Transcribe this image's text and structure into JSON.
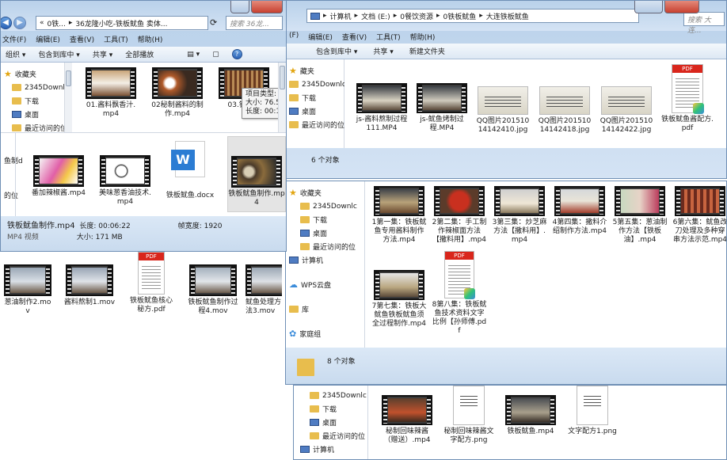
{
  "win_left": {
    "address_parts": [
      "0铁...",
      "36龙隆小吃-铁板鱿鱼 卖体..."
    ],
    "search_placeholder": "搜索 36龙...",
    "menu": [
      "文件(F)",
      "编辑(E)",
      "查看(V)",
      "工具(T)",
      "帮助(H)"
    ],
    "toolbar": [
      "组织",
      "包含到库中",
      "共享",
      "全部播放"
    ],
    "nav": [
      "收藏夹",
      "2345Downlc",
      "下载",
      "桌面",
      "最近访问的位"
    ],
    "files_row1": [
      "01.酱料飘香汁.mp4",
      "02秘制酱料的制作.mp4",
      "03.铁板..."
    ],
    "tooltip": [
      "项目类型: MP4 视频",
      "大小: 76.5 MB",
      "长度: 00:18:36"
    ],
    "nav2": [
      "鱼制d",
      "的位"
    ],
    "files_row2": [
      "番加辣椒酱.mp4",
      "美味葱香油技术.mp4",
      "铁板鱿鱼.docx",
      "铁板鱿鱼制作.mp4"
    ],
    "status": {
      "name": "铁板鱿鱼制作.mp4",
      "length_label": "长度: 00:06:22",
      "frame_label": "帧宽度: 1920",
      "type": "MP4 视频",
      "size_label": "大小: 171 MB"
    }
  },
  "win_right": {
    "address_parts": [
      "计算机",
      "文档 (E:)",
      "0餐饮资源",
      "0铁板鱿鱼",
      "大连铁板鱿鱼"
    ],
    "search_placeholder": "搜索 大连...",
    "menu": [
      "(F)",
      "编辑(E)",
      "查看(V)",
      "工具(T)",
      "帮助(H)"
    ],
    "toolbar": [
      "包含到库中",
      "共享",
      "新建文件夹"
    ],
    "nav": [
      "藏夹",
      "2345Downlc",
      "下载",
      "桌面",
      "最近访问的位"
    ],
    "files": [
      "js-酱料熬制过程111.MP4",
      "js-鱿鱼烤制过程.MP4",
      "QQ图片20151014142410.jpg",
      "QQ图片20151014142418.jpg",
      "QQ图片20151014142422.jpg",
      "铁板鱿鱼酱配方.pdf"
    ],
    "count": "6 个对象"
  },
  "win_mid": {
    "nav": [
      "收藏夹",
      "2345Downlc",
      "下载",
      "桌面",
      "最近访问的位",
      "计算机",
      "WPS云盘",
      "库",
      "家庭组"
    ],
    "files": [
      "1第一集：铁板鱿鱼专用酱料制作方法.mp4",
      "2第二集：手工制作辣椒面方法【撒料用】.mp4",
      "3第三集：炒芝麻方法【撒料用】.mp4",
      "4第四集：撒料介绍制作方法.mp4",
      "5第五集：葱油制作方法【铁板油】.mp4",
      "6第六集：鱿鱼改刀处理及多种穿串方法示范.mp4",
      "7第七集：铁板大鱿鱼铁板鱿鱼须全过程制作.mp4",
      "8第八集：铁板鱿鱼技术资料文字比例【孙师傅.pdf"
    ],
    "count": "8 个对象"
  },
  "win_bg_files": [
    "葱油制作2.mov",
    "酱料熬制1.mov",
    "铁板鱿鱼核心秘方.pdf",
    "铁板鱿鱼制作过程4.mov",
    "鱿鱼处理方法3.mov"
  ],
  "win_bottom": {
    "nav": [
      "2345Downlc",
      "下载",
      "桌面",
      "最近访问的位",
      "计算机"
    ],
    "files": [
      "秘制回味辣酱（赠送）.mp4",
      "秘制回味辣酱文字配方.png",
      "铁板鱿鱼.mp4",
      "文字配方1.png"
    ]
  },
  "pdf_tag": "PDF",
  "docx_letter": "W",
  "colors": {
    "glass": "#c8daee",
    "pdf_red": "#d9261c",
    "word_blue": "#2b7cd3",
    "close_red": "#c7402f"
  }
}
